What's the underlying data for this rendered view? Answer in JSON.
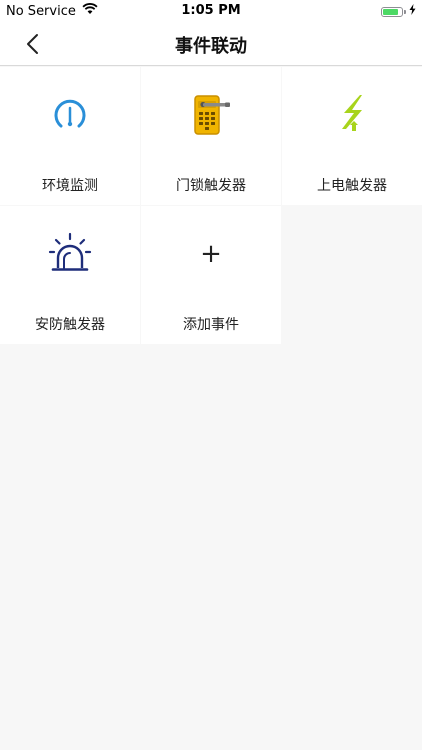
{
  "status_bar": {
    "carrier": "No Service",
    "time": "1:05 PM",
    "battery_level": 0.85,
    "battery_color": "#4cd964"
  },
  "nav": {
    "title": "事件联动",
    "back_icon": "chevron-left-icon"
  },
  "tiles": [
    {
      "label": "环境监测",
      "icon": "gauge-icon",
      "color": "#2a8fd8"
    },
    {
      "label": "门锁触发器",
      "icon": "door-lock-icon",
      "color": "#f0b400"
    },
    {
      "label": "上电触发器",
      "icon": "lightning-icon",
      "color": "#a8d41c"
    },
    {
      "label": "安防触发器",
      "icon": "alarm-light-icon",
      "color": "#1e2d7a"
    },
    {
      "label": "添加事件",
      "icon": "plus-icon",
      "symbol": "+"
    }
  ]
}
